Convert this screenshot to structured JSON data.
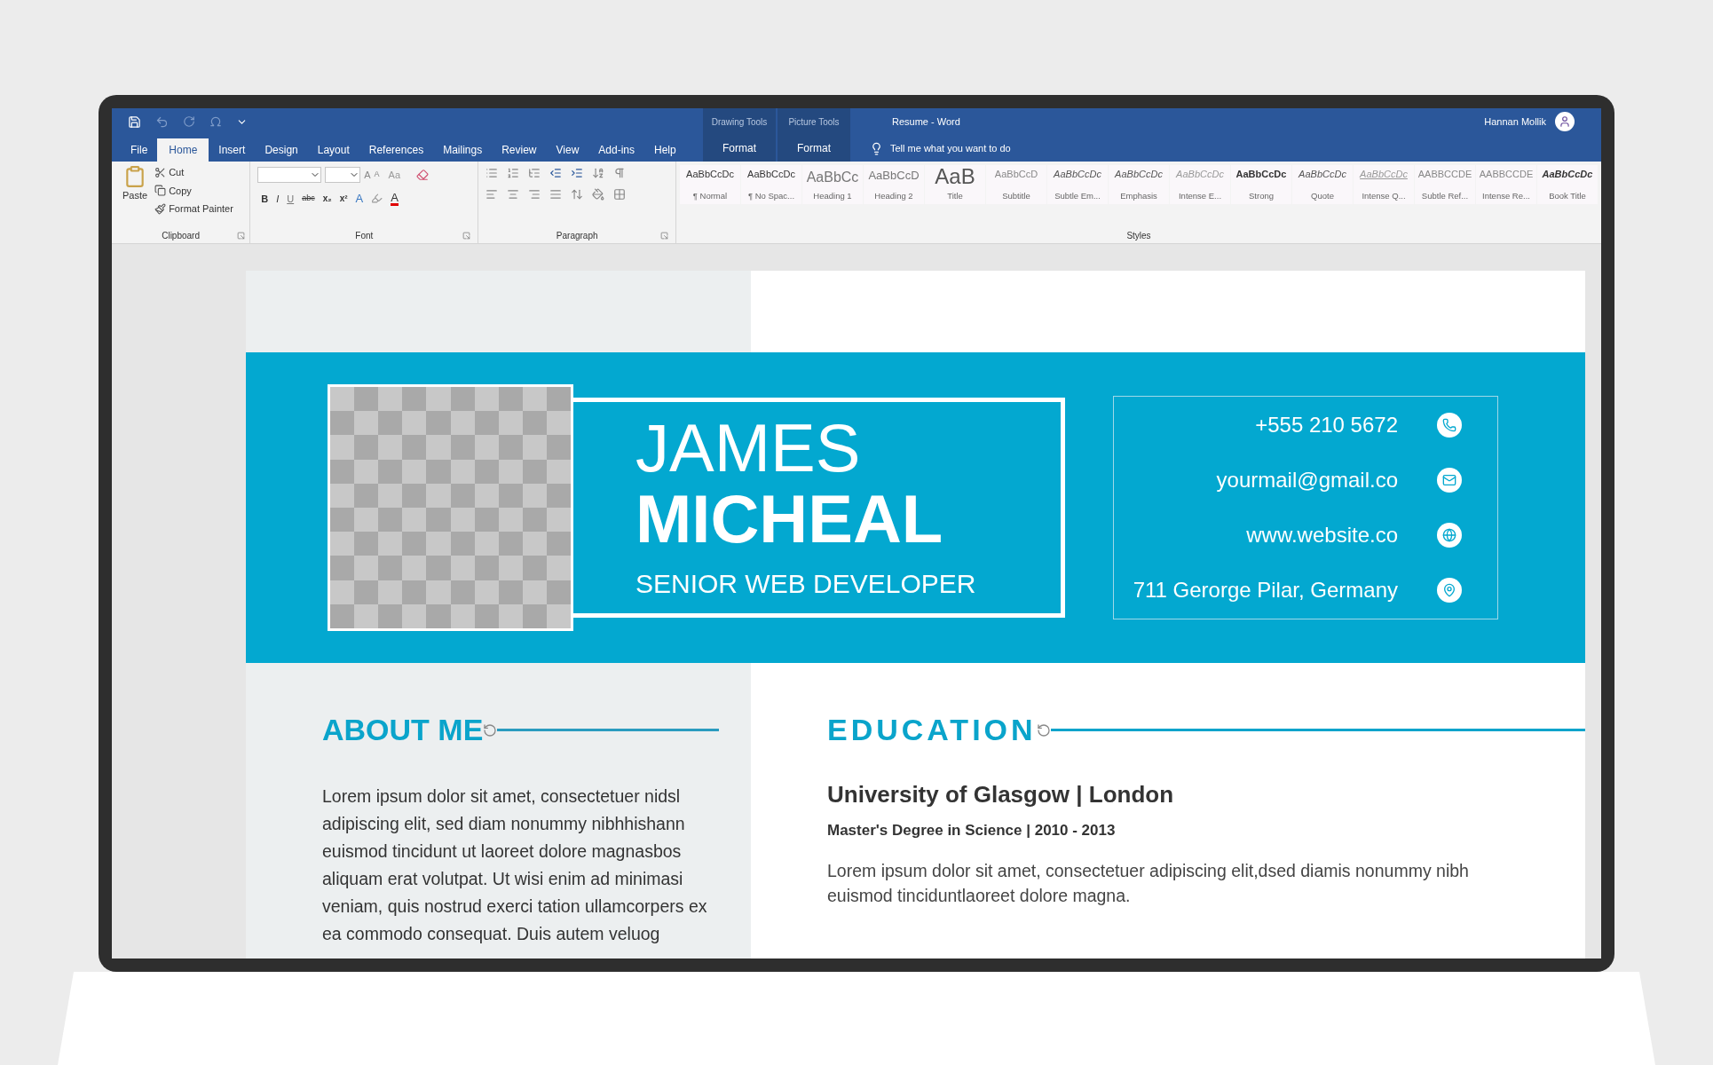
{
  "window": {
    "title": "Resume  -  Word",
    "account": "Hannan Mollik"
  },
  "contextual_tabs": [
    {
      "group": "Drawing Tools",
      "tab": "Format"
    },
    {
      "group": "Picture Tools",
      "tab": "Format"
    }
  ],
  "tabs": [
    {
      "label": "File",
      "selected": false
    },
    {
      "label": "Home",
      "selected": true
    },
    {
      "label": "Insert",
      "selected": false
    },
    {
      "label": "Design",
      "selected": false
    },
    {
      "label": "Layout",
      "selected": false
    },
    {
      "label": "References",
      "selected": false
    },
    {
      "label": "Mailings",
      "selected": false
    },
    {
      "label": "Review",
      "selected": false
    },
    {
      "label": "View",
      "selected": false
    },
    {
      "label": "Add-ins",
      "selected": false
    },
    {
      "label": "Help",
      "selected": false
    }
  ],
  "tell_me": "Tell me what you want to do",
  "clipboard": {
    "paste": "Paste",
    "items": [
      "Cut",
      "Copy",
      "Format Painter"
    ],
    "label": "Clipboard"
  },
  "font": {
    "label": "Font",
    "grow": "A",
    "shrink": "A",
    "case": "Aa",
    "effects": "A",
    "font_color_letter": "A",
    "buttons": [
      "B",
      "I",
      "U",
      "abc",
      "x₂",
      "x²"
    ]
  },
  "paragraph": {
    "label": "Paragraph"
  },
  "styles": {
    "label": "Styles",
    "items": [
      {
        "preview": "AaBbCcDc",
        "name": "¶ Normal",
        "kind": "plain"
      },
      {
        "preview": "AaBbCcDc",
        "name": "¶ No Spac...",
        "kind": "plain"
      },
      {
        "preview": "AaBbCc",
        "name": "Heading 1",
        "kind": "heading"
      },
      {
        "preview": "AaBbCcD",
        "name": "Heading 2",
        "kind": "heading2"
      },
      {
        "preview": "AaB",
        "name": "Title",
        "kind": "title"
      },
      {
        "preview": "AaBbCcD",
        "name": "Subtitle",
        "kind": "light"
      },
      {
        "preview": "AaBbCcDc",
        "name": "Subtle Em...",
        "kind": "italic"
      },
      {
        "preview": "AaBbCcDc",
        "name": "Emphasis",
        "kind": "italic"
      },
      {
        "preview": "AaBbCcDc",
        "name": "Intense E...",
        "kind": "italiclight"
      },
      {
        "preview": "AaBbCcDc",
        "name": "Strong",
        "kind": "bold"
      },
      {
        "preview": "AaBbCcDc",
        "name": "Quote",
        "kind": "italic"
      },
      {
        "preview": "AaBbCcDc",
        "name": "Intense Q...",
        "kind": "quote"
      },
      {
        "preview": "AABBCCDE",
        "name": "Subtle Ref...",
        "kind": "light"
      },
      {
        "preview": "AABBCCDE",
        "name": "Intense Re...",
        "kind": "light"
      },
      {
        "preview": "AaBbCcDc",
        "name": "Book Title",
        "kind": "bolditalic"
      }
    ]
  },
  "resume": {
    "first_name": "JAMES",
    "last_name": "MICHEAL",
    "role": "SENIOR WEB DEVELOPER",
    "contacts": [
      {
        "kind": "phone",
        "text": "+555 210 5672"
      },
      {
        "kind": "email",
        "text": "yourmail@gmail.co"
      },
      {
        "kind": "web",
        "text": "www.website.co"
      },
      {
        "kind": "location",
        "text": "711 Gerorge Pilar, Germany"
      }
    ],
    "about": {
      "heading": "ABOUT ME",
      "text": "Lorem ipsum dolor sit amet, consectetuer nidsl adipiscing elit, sed diam nonummy nibhhishann euismod tincidunt ut laoreet dolore magnasbos aliquam erat volutpat. Ut wisi enim ad minimasi veniam, quis nostrud exerci tation ullamcorpers ex ea commodo consequat. Duis autem veluog"
    },
    "education": {
      "heading": "EDUCATION",
      "school": "University of Glasgow | London",
      "degree": "Master's Degree in Science | 2010 - 2013",
      "text": "Lorem ipsum dolor sit amet, consectetuer adipiscing elit,dsed diamis nonummy nibh euismod tinciduntlaoreet dolore magna."
    }
  }
}
